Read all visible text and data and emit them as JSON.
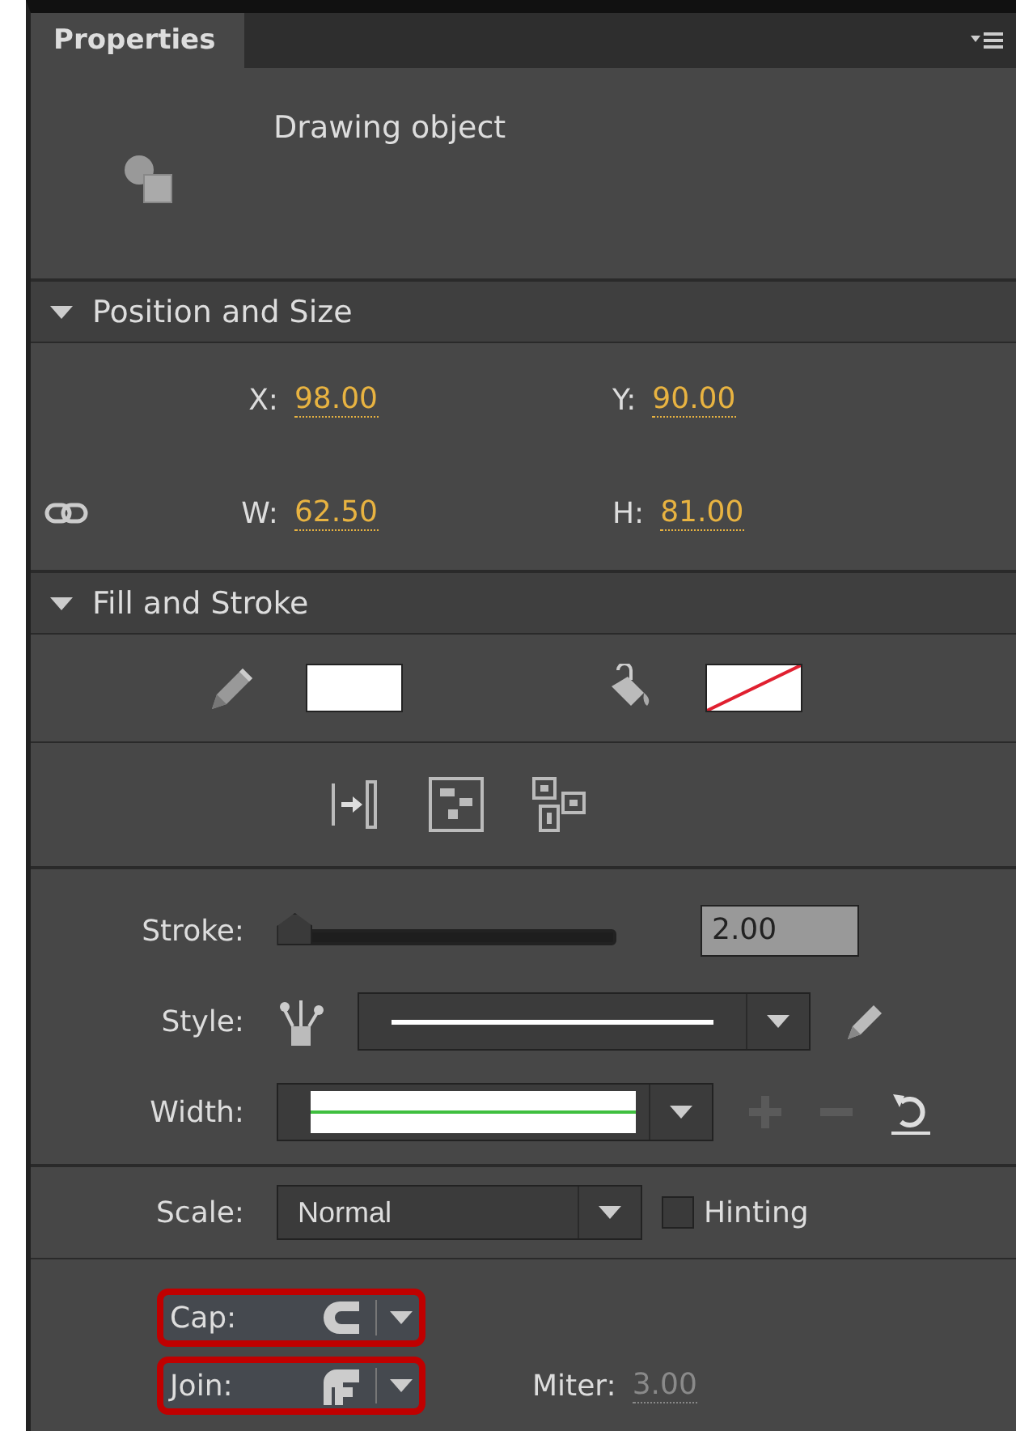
{
  "panel": {
    "tab": "Properties",
    "object_type": "Drawing object"
  },
  "position_and_size": {
    "title": "Position and Size",
    "expanded": true,
    "fields": [
      {
        "label": "X:",
        "value": "98.00"
      },
      {
        "label": "Y:",
        "value": "90.00"
      },
      {
        "label": "W:",
        "value": "62.50"
      },
      {
        "label": "H:",
        "value": "81.00"
      }
    ]
  },
  "fill_and_stroke": {
    "title": "Fill and Stroke",
    "expanded": true,
    "stroke_none": false,
    "fill_none": true,
    "stroke": {
      "label": "Stroke:",
      "level": 0.02,
      "value": "2.00"
    },
    "style": {
      "label": "Style:"
    },
    "width": {
      "label": "Width:"
    },
    "scale": {
      "label": "Scale:",
      "value": "Normal"
    },
    "hinting": {
      "label": "Hinting",
      "checked": false
    },
    "cap": {
      "label": "Cap:",
      "highlighted": true
    },
    "join": {
      "label": "Join:",
      "highlighted": true
    },
    "miter": {
      "label": "Miter:",
      "value": "3.00",
      "disabled": true
    }
  }
}
